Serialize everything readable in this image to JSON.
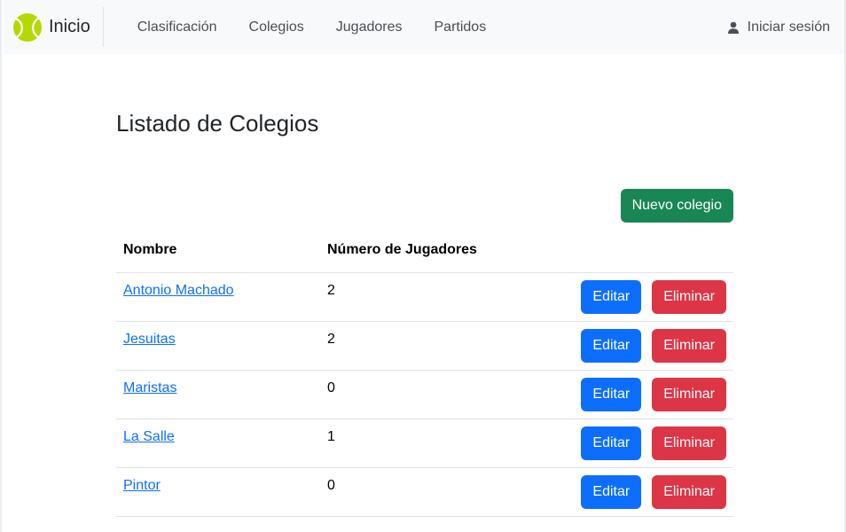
{
  "nav": {
    "brand": "Inicio",
    "links": [
      "Clasificación",
      "Colegios",
      "Jugadores",
      "Partidos"
    ],
    "login": "Iniciar sesión",
    "brand_icon": "tennis-ball-icon",
    "login_icon": "user-icon"
  },
  "page": {
    "title": "Listado de Colegios",
    "new_button": "Nuevo colegio"
  },
  "table": {
    "headers": [
      "Nombre",
      "Número de Jugadores",
      ""
    ],
    "rows": [
      {
        "name": "Antonio Machado",
        "players": "2"
      },
      {
        "name": "Jesuitas",
        "players": "2"
      },
      {
        "name": "Maristas",
        "players": "0"
      },
      {
        "name": "La Salle",
        "players": "1"
      },
      {
        "name": "Pintor",
        "players": "0"
      }
    ],
    "edit_label": "Editar",
    "delete_label": "Eliminar"
  },
  "colors": {
    "primary": "#0d6efd",
    "success": "#198754",
    "danger": "#dc3545",
    "navbar_bg": "#f8f9fa",
    "ball": "#b5d900"
  }
}
